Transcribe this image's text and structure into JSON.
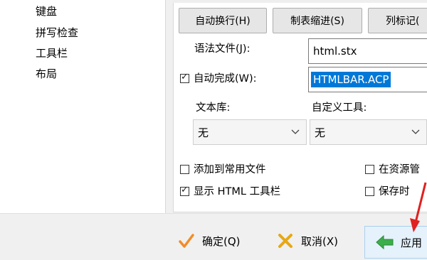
{
  "tree": {
    "items": [
      "键盘",
      "拼写检查",
      "工具栏",
      "布局"
    ]
  },
  "toolbar_buttons": {
    "auto_wrap": "自动换行(H)",
    "tab_indent": "制表缩进(S)",
    "column_mark": "列标记("
  },
  "grammar": {
    "label": "语法文件(J):",
    "value": "html.stx"
  },
  "autocomplete": {
    "label": "自动完成(W):",
    "checked": true,
    "value": "HTMLBAR.ACP"
  },
  "text_library": {
    "label": "文本库:",
    "selected": "无"
  },
  "custom_tools": {
    "label": "自定义工具:",
    "selected": "无"
  },
  "options": {
    "add_to_common_files": "添加到常用文件",
    "show_html_toolbar": "显示 HTML 工具栏",
    "in_resource_manager": "在资源管",
    "save_time": "保存时"
  },
  "dialog_buttons": {
    "ok": "确定(Q)",
    "cancel": "取消(X)",
    "apply": "应用"
  },
  "colors": {
    "selection": "#0078d7",
    "ok_check": "#f28c28",
    "cancel_x": "#e6a817",
    "apply_arrow": "#3cae4b",
    "annotation_arrow": "#e02020"
  }
}
